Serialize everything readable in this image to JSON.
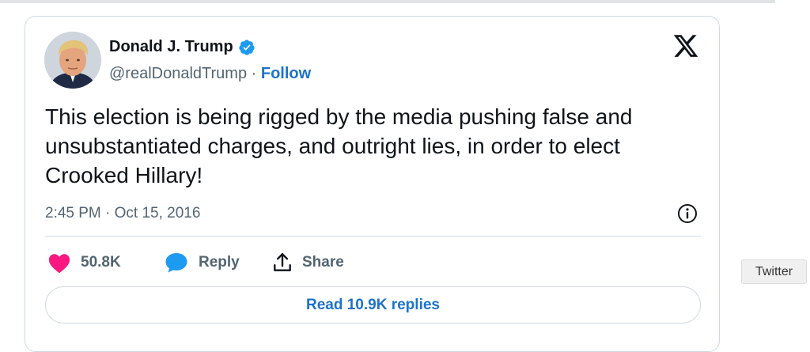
{
  "tweet": {
    "author": {
      "name": "Donald J. Trump",
      "handle": "@realDonaldTrump",
      "separator": "·",
      "follow_label": "Follow",
      "verified": true,
      "avatar_icon": "profile-photo"
    },
    "platform_icon": "x-logo-icon",
    "text": "This election is being rigged by the media pushing false and unsubstantiated charges, and outright lies, in order to elect Crooked Hillary!",
    "timestamp": "2:45 PM · Oct 15, 2016",
    "actions": {
      "like_count": "50.8K",
      "reply_label": "Reply",
      "share_label": "Share"
    },
    "read_replies_label": "Read 10.9K replies"
  },
  "tooltip": {
    "text": "Twitter"
  },
  "colors": {
    "link_blue": "#1d72c9",
    "verified_blue": "#1d9bf0",
    "like_pink": "#f91880",
    "reply_blue": "#1d9bf0",
    "muted_text": "#536471",
    "border": "#cfd9de"
  }
}
